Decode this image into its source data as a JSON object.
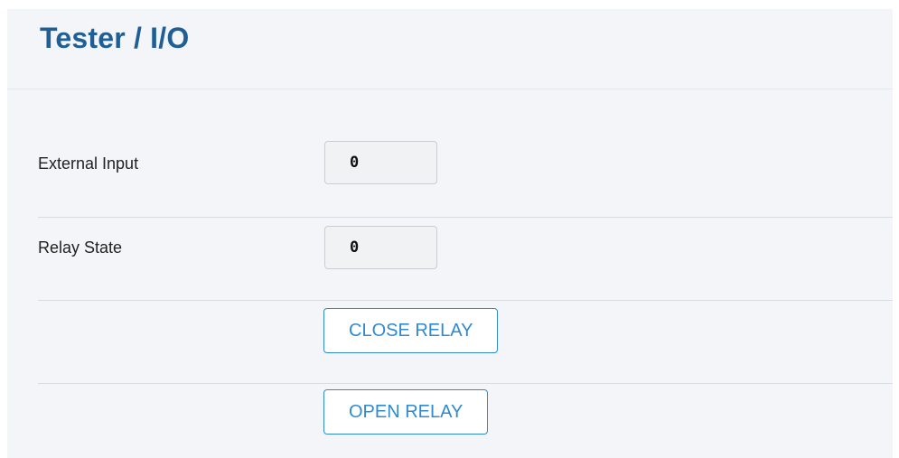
{
  "page": {
    "title": "Tester / I/O"
  },
  "io": {
    "external_input": {
      "label": "External Input",
      "value": "0"
    },
    "relay_state": {
      "label": "Relay State",
      "value": "0"
    }
  },
  "actions": {
    "close_relay_label": "CLOSE RELAY",
    "open_relay_label": "OPEN RELAY"
  },
  "colors": {
    "title": "#1f5f95",
    "button_accent": "#2f8ad0",
    "panel_background": "#f3f5f9"
  }
}
